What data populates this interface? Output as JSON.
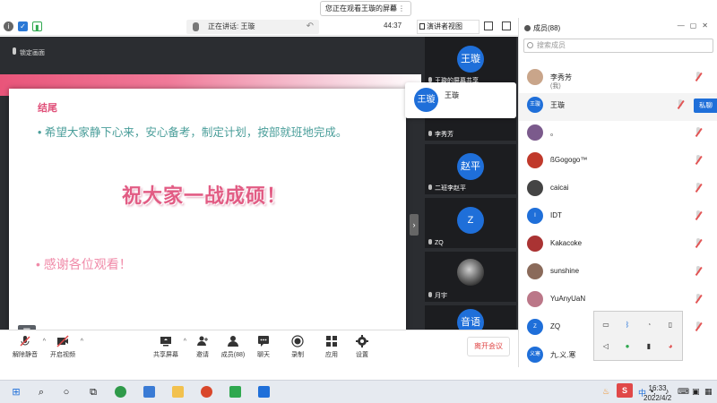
{
  "banner": {
    "text": "您正在观看王璇的屏幕",
    "controls": "⊡ ⋮"
  },
  "topbar": {
    "talking": "正在讲话: 王璇",
    "timer": "44:37",
    "view_label": "演讲者视图"
  },
  "stage": {
    "lock_label": "锁定画面",
    "slide": {
      "heading": "结尾",
      "line1": "• 希望大家静下心来，安心备考，制定计划，按部就班地完成。",
      "big": "祝大家一战成硕！",
      "thanks": "• 感谢各位观看！"
    }
  },
  "speaker_popup": {
    "avatar": "王璇",
    "name": "王璇"
  },
  "video_tiles": [
    {
      "avatar": "王璇",
      "label": "王璇的屏幕共享",
      "photo": false
    },
    {
      "avatar": "",
      "label": "李秀芳",
      "photo": false
    },
    {
      "avatar": "赵平",
      "label": "二班李赵平",
      "photo": false
    },
    {
      "avatar": "Z",
      "label": "ZQ",
      "photo": false
    },
    {
      "avatar": "",
      "label": "月宇",
      "photo": true
    },
    {
      "avatar": "音语",
      "label": "",
      "photo": false
    }
  ],
  "toolbar": {
    "unmute": "解除静音",
    "video": "开启视频",
    "share": "共享屏幕",
    "invite": "邀请",
    "members": "成员(88)",
    "chat": "聊天",
    "record": "录制",
    "apps": "应用",
    "settings": "设置",
    "leave": "离开会议"
  },
  "participants": {
    "title": "成员(88)",
    "search_placeholder": "搜索成员",
    "private_chat": "私聊",
    "list": [
      {
        "name": "李秀芳",
        "sub": "(我)",
        "avatar": "",
        "color": "#c9a58a"
      },
      {
        "name": "王璇",
        "sub": "",
        "avatar": "王璇",
        "color": "#1f6fd9"
      },
      {
        "name": "。",
        "sub": "",
        "avatar": "",
        "color": "#7b5a8c"
      },
      {
        "name": "ßGogogo™",
        "sub": "",
        "avatar": "",
        "color": "#c0392b"
      },
      {
        "name": "caicai",
        "sub": "",
        "avatar": "",
        "color": "#444"
      },
      {
        "name": "IDT",
        "sub": "",
        "avatar": "I",
        "color": "#1f6fd9"
      },
      {
        "name": "Kakacoke",
        "sub": "",
        "avatar": "",
        "color": "#a33"
      },
      {
        "name": "sunshine",
        "sub": "",
        "avatar": "",
        "color": "#8a6a5a"
      },
      {
        "name": "YuAnyUaN",
        "sub": "",
        "avatar": "",
        "color": "#b78"
      },
      {
        "name": "ZQ",
        "sub": "",
        "avatar": "Z",
        "color": "#1f6fd9"
      },
      {
        "name": "九.义.寒",
        "sub": "",
        "avatar": "义寒",
        "color": "#1f6fd9"
      }
    ]
  },
  "taskbar": {
    "ime": "中",
    "time": "16:33",
    "date": "2022/4/2"
  }
}
